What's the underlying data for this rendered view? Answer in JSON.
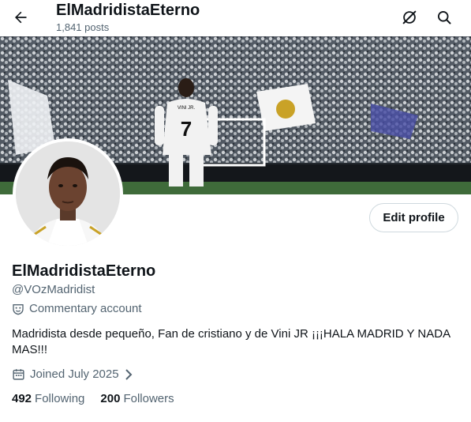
{
  "header": {
    "title": "ElMadridistaEterno",
    "post_count": "1,841 posts",
    "back_icon": "arrow-left-icon",
    "grok_icon": "grok-slash-icon",
    "search_icon": "search-icon"
  },
  "banner": {
    "player_number": "7",
    "player_name": "VINI JR."
  },
  "profile": {
    "edit_label": "Edit profile",
    "display_name": "ElMadridistaEterno",
    "handle": "@VOzMadridist",
    "account_type": "Commentary account",
    "bio": "Madridista desde pequeño, Fan de cristiano y de Vini JR ¡¡¡HALA MADRID Y NADA MAS!!!",
    "joined": "Joined July 2025",
    "following_count": "492",
    "following_label": "Following",
    "followers_count": "200",
    "followers_label": "Followers"
  },
  "colors": {
    "text": "#0f1419",
    "muted": "#536471",
    "border": "#cfd9de"
  }
}
